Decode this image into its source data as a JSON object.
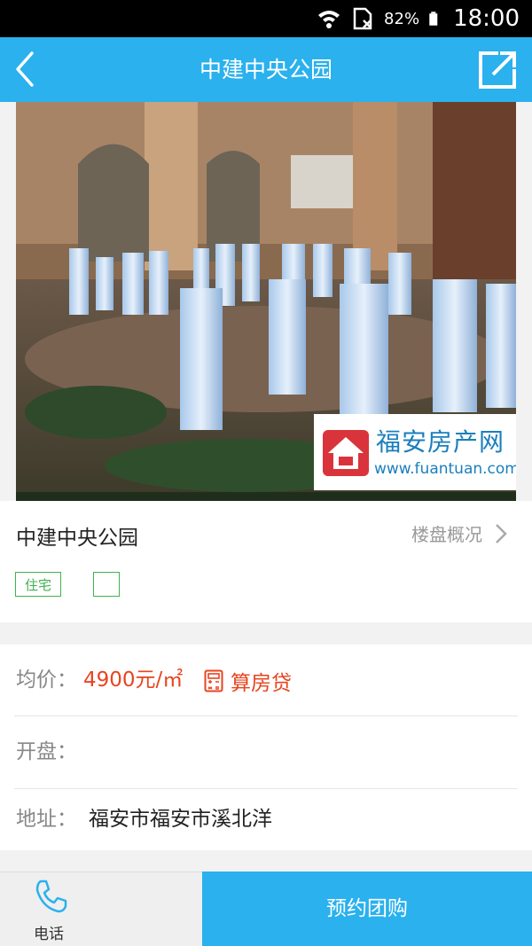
{
  "status_bar": {
    "battery_percent": "82%",
    "time": "18:00",
    "icons": [
      "wifi-icon",
      "sim-icon",
      "battery-icon"
    ]
  },
  "nav": {
    "title": "中建中央公园",
    "back_icon": "back-chevron-icon",
    "share_icon": "share-icon"
  },
  "hero": {
    "watermark_name": "福安房产网",
    "watermark_url": "www.fuantuan.com",
    "watermark_logo_text": "福安房产网"
  },
  "info": {
    "project_name": "中建中央公园",
    "overview_link": "楼盘概况",
    "tags": [
      "住宅",
      ""
    ]
  },
  "details": {
    "avg_price_label": "均价：",
    "avg_price_value": "4900元/㎡",
    "mortgage_calc_label": "算房贷",
    "opening_label": "开盘：",
    "opening_value": "",
    "address_label": "地址：",
    "address_value": "福安市福安市溪北洋"
  },
  "bottom_bar": {
    "phone_label": "电话",
    "group_buy_label": "预约团购"
  },
  "colors": {
    "accent_blue": "#2ab1ee",
    "price_red": "#e8441f",
    "tag_green": "#3fb34f"
  }
}
